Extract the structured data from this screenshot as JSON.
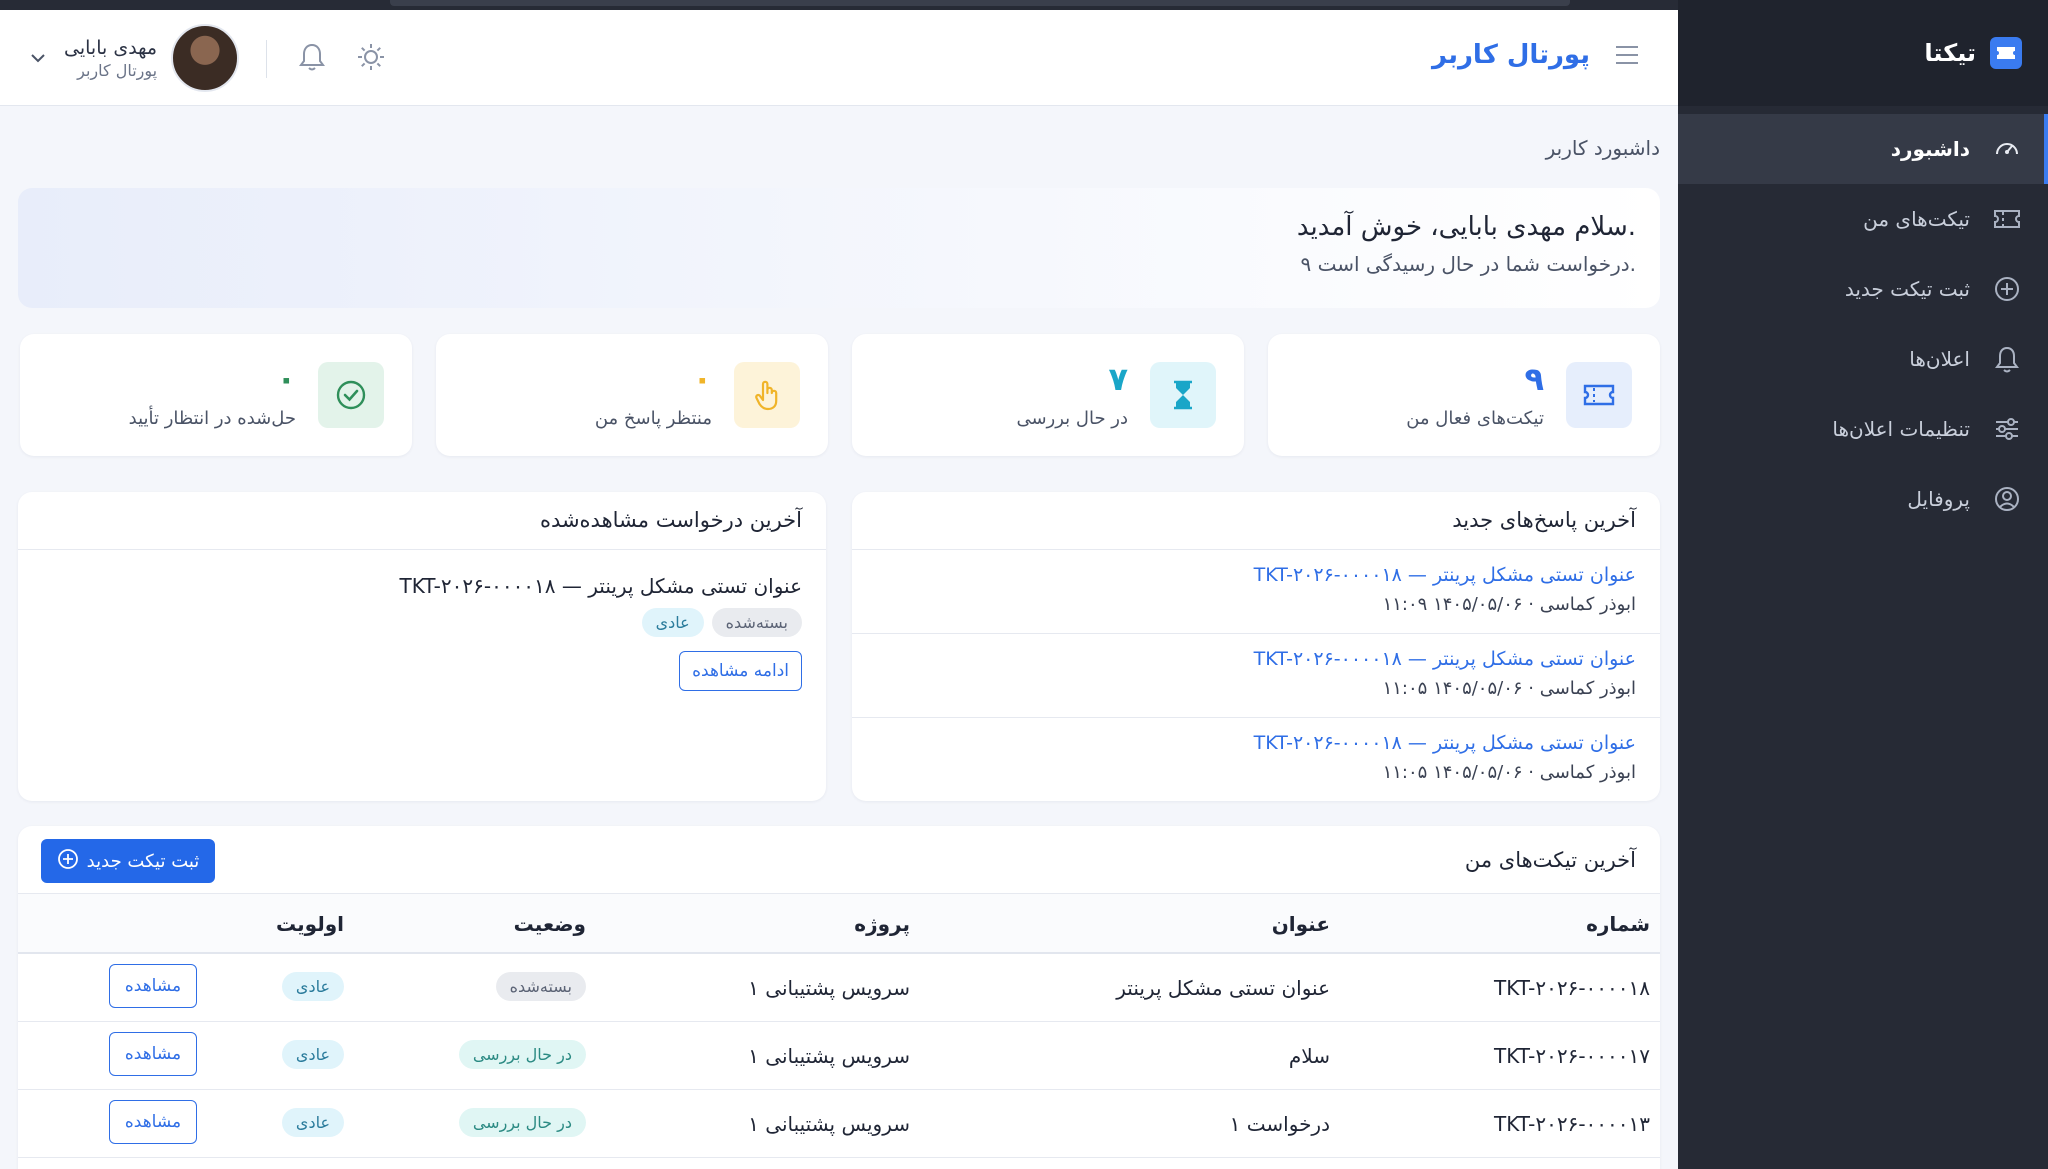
{
  "app": {
    "brand": "تیکتا"
  },
  "sidebar": {
    "items": [
      {
        "label": "داشبورد",
        "icon": "dashboard-icon",
        "active": true
      },
      {
        "label": "تیکت‌های من",
        "icon": "ticket-icon",
        "active": false
      },
      {
        "label": "ثبت تیکت جدید",
        "icon": "plus-circle-icon",
        "active": false
      },
      {
        "label": "اعلان‌ها",
        "icon": "bell-icon",
        "active": false
      },
      {
        "label": "تنظیمات اعلان‌ها",
        "icon": "sliders-icon",
        "active": false
      },
      {
        "label": "پروفایل",
        "icon": "user-circle-icon",
        "active": false
      }
    ]
  },
  "header": {
    "title": "پورتال کاربر",
    "user_name": "مهدی بابایی",
    "user_role": "پورتال کاربر"
  },
  "breadcrumb": "داشبورد کاربر",
  "welcome": {
    "title": "سلام مهدی بابایی، خوش آمدید.",
    "subtitle": "۹ درخواست شما در حال رسیدگی است."
  },
  "stats": [
    {
      "value": "۹",
      "label": "تیکت‌های فعال من",
      "icon": "ticket-icon",
      "color": "#2f6ee6",
      "bg": "#e6eefc"
    },
    {
      "value": "۷",
      "label": "در حال بررسی",
      "icon": "hourglass-icon",
      "color": "#1aa6c8",
      "bg": "#e0f5fa"
    },
    {
      "value": "۰",
      "label": "منتظر پاسخ من",
      "icon": "hand-pointer-icon",
      "color": "#f0b429",
      "bg": "#fdf3d9"
    },
    {
      "value": "۰",
      "label": "حل‌شده در انتظار تأیید",
      "icon": "check-circle-icon",
      "color": "#2f8f5a",
      "bg": "#e3f3ea"
    }
  ],
  "replies": {
    "title": "آخرین پاسخ‌های جدید",
    "items": [
      {
        "link": "TKT-۲۰۲۶-۰۰۰۰۱۸ — عنوان تستی مشکل پرینتر",
        "meta": "ابوذر کماسی · ۱۴۰۵/۰۵/۰۶ ۱۱:۰۹"
      },
      {
        "link": "TKT-۲۰۲۶-۰۰۰۰۱۸ — عنوان تستی مشکل پرینتر",
        "meta": "ابوذر کماسی · ۱۴۰۵/۰۵/۰۶ ۱۱:۰۵"
      },
      {
        "link": "TKT-۲۰۲۶-۰۰۰۰۱۸ — عنوان تستی مشکل پرینتر",
        "meta": "ابوذر کماسی · ۱۴۰۵/۰۵/۰۶ ۱۱:۰۵"
      }
    ]
  },
  "last_viewed": {
    "title": "آخرین درخواست مشاهده‌شده",
    "ticket": "TKT-۲۰۲۶-۰۰۰۰۱۸ — عنوان تستی مشکل پرینتر",
    "status": "بسته‌شده",
    "priority": "عادی",
    "button": "ادامه مشاهده"
  },
  "tickets": {
    "title": "آخرین تیکت‌های من",
    "new_button": "ثبت تیکت جدید",
    "columns": [
      "شماره",
      "عنوان",
      "پروژه",
      "وضعیت",
      "اولویت"
    ],
    "rows": [
      {
        "number": "TKT-۲۰۲۶-۰۰۰۰۱۸",
        "title": "عنوان تستی مشکل پرینتر",
        "project": "سرویس پشتیبانی ۱",
        "status": "بسته‌شده",
        "priority": "عادی",
        "action": "مشاهده"
      },
      {
        "number": "TKT-۲۰۲۶-۰۰۰۰۱۷",
        "title": "سلام",
        "project": "سرویس پشتیبانی ۱",
        "status": "در حال بررسی",
        "priority": "عادی",
        "action": "مشاهده"
      },
      {
        "number": "TKT-۲۰۲۶-۰۰۰۰۱۳",
        "title": "درخواست ۱",
        "project": "سرویس پشتیبانی ۱",
        "status": "در حال بررسی",
        "priority": "عادی",
        "action": "مشاهده"
      }
    ]
  }
}
